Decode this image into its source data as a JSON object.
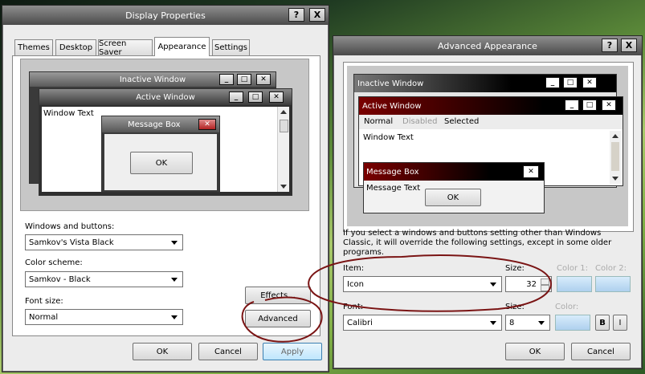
{
  "display": {
    "title": "Display Properties",
    "help_label": "?",
    "close_label": "X",
    "tabs": [
      "Themes",
      "Desktop",
      "Screen Saver",
      "Appearance",
      "Settings"
    ],
    "preview": {
      "inactive_title": "Inactive Window",
      "active_title": "Active Window",
      "window_text": "Window Text",
      "msgbox_title": "Message Box",
      "ok_label": "OK"
    },
    "windows_buttons_label": "Windows and buttons:",
    "windows_buttons_value": "Samkov's Vista Black",
    "color_scheme_label": "Color scheme:",
    "color_scheme_value": "Samkov - Black",
    "font_size_label": "Font size:",
    "font_size_value": "Normal",
    "effects_label": "Effects...",
    "advanced_label": "Advanced",
    "ok_label": "OK",
    "cancel_label": "Cancel",
    "apply_label": "Apply"
  },
  "advanced": {
    "title": "Advanced Appearance",
    "help_label": "?",
    "close_label": "X",
    "preview": {
      "inactive_title": "Inactive Window",
      "active_title": "Active Window",
      "menu_normal": "Normal",
      "menu_disabled": "Disabled",
      "menu_selected": "Selected",
      "window_text": "Window Text",
      "msgbox_title": "Message Box",
      "msgbox_text": "Message Text",
      "ok_label": "OK"
    },
    "info_text": "If you select a windows and buttons setting other than Windows Classic, it will override the following settings, except in some older programs.",
    "item_label": "Item:",
    "item_value": "Icon",
    "size_label": "Size:",
    "size_value": "32",
    "color1_label": "Color 1:",
    "color2_label": "Color 2:",
    "font_label": "Font:",
    "font_value": "Calibri",
    "font_size_label": "Size:",
    "font_size_value": "8",
    "font_color_label": "Color:",
    "bold_label": "B",
    "italic_label": "I",
    "ok_label": "OK",
    "cancel_label": "Cancel"
  },
  "colors": {
    "active_title_start": "#7a0000",
    "active_title_end": "#000000",
    "annotation": "#7a1414"
  }
}
